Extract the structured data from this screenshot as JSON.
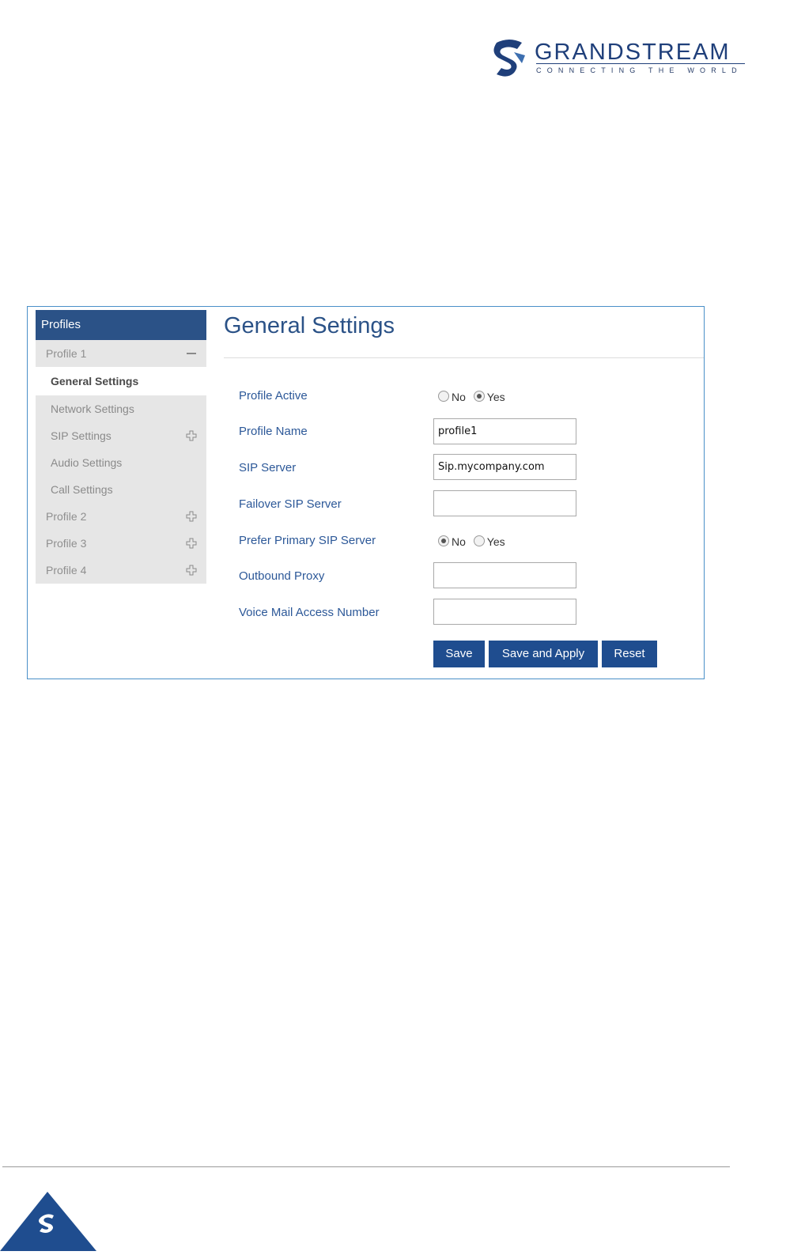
{
  "header": {
    "brand": "GRANDSTREAM",
    "tagline": "CONNECTING THE WORLD"
  },
  "sidebar": {
    "title": "Profiles",
    "profiles": [
      {
        "label": "Profile 1",
        "state": "expanded",
        "items": [
          {
            "label": "General Settings",
            "active": true
          },
          {
            "label": "Network Settings"
          },
          {
            "label": "SIP Settings",
            "expandable": true
          },
          {
            "label": "Audio Settings"
          },
          {
            "label": "Call Settings"
          }
        ]
      },
      {
        "label": "Profile 2",
        "state": "collapsed"
      },
      {
        "label": "Profile 3",
        "state": "collapsed"
      },
      {
        "label": "Profile 4",
        "state": "collapsed"
      }
    ]
  },
  "main": {
    "title": "General Settings",
    "fields": {
      "profile_active": {
        "label": "Profile Active",
        "options": [
          "No",
          "Yes"
        ],
        "selected": "Yes"
      },
      "profile_name": {
        "label": "Profile Name",
        "value": "profile1"
      },
      "sip_server": {
        "label": "SIP Server",
        "value": "Sip.mycompany.com"
      },
      "failover_sip_server": {
        "label": "Failover SIP Server",
        "value": ""
      },
      "prefer_primary_sip_server": {
        "label": "Prefer Primary SIP Server",
        "options": [
          "No",
          "Yes"
        ],
        "selected": "No"
      },
      "outbound_proxy": {
        "label": "Outbound Proxy",
        "value": ""
      },
      "voice_mail_access_number": {
        "label": "Voice Mail Access Number",
        "value": ""
      }
    },
    "buttons": {
      "save": "Save",
      "save_apply": "Save and Apply",
      "reset": "Reset"
    }
  },
  "colors": {
    "brand_navy": "#2b5287",
    "button_blue": "#1f4d8f",
    "label_blue": "#2c5898",
    "frame_border": "#4a90c8"
  }
}
